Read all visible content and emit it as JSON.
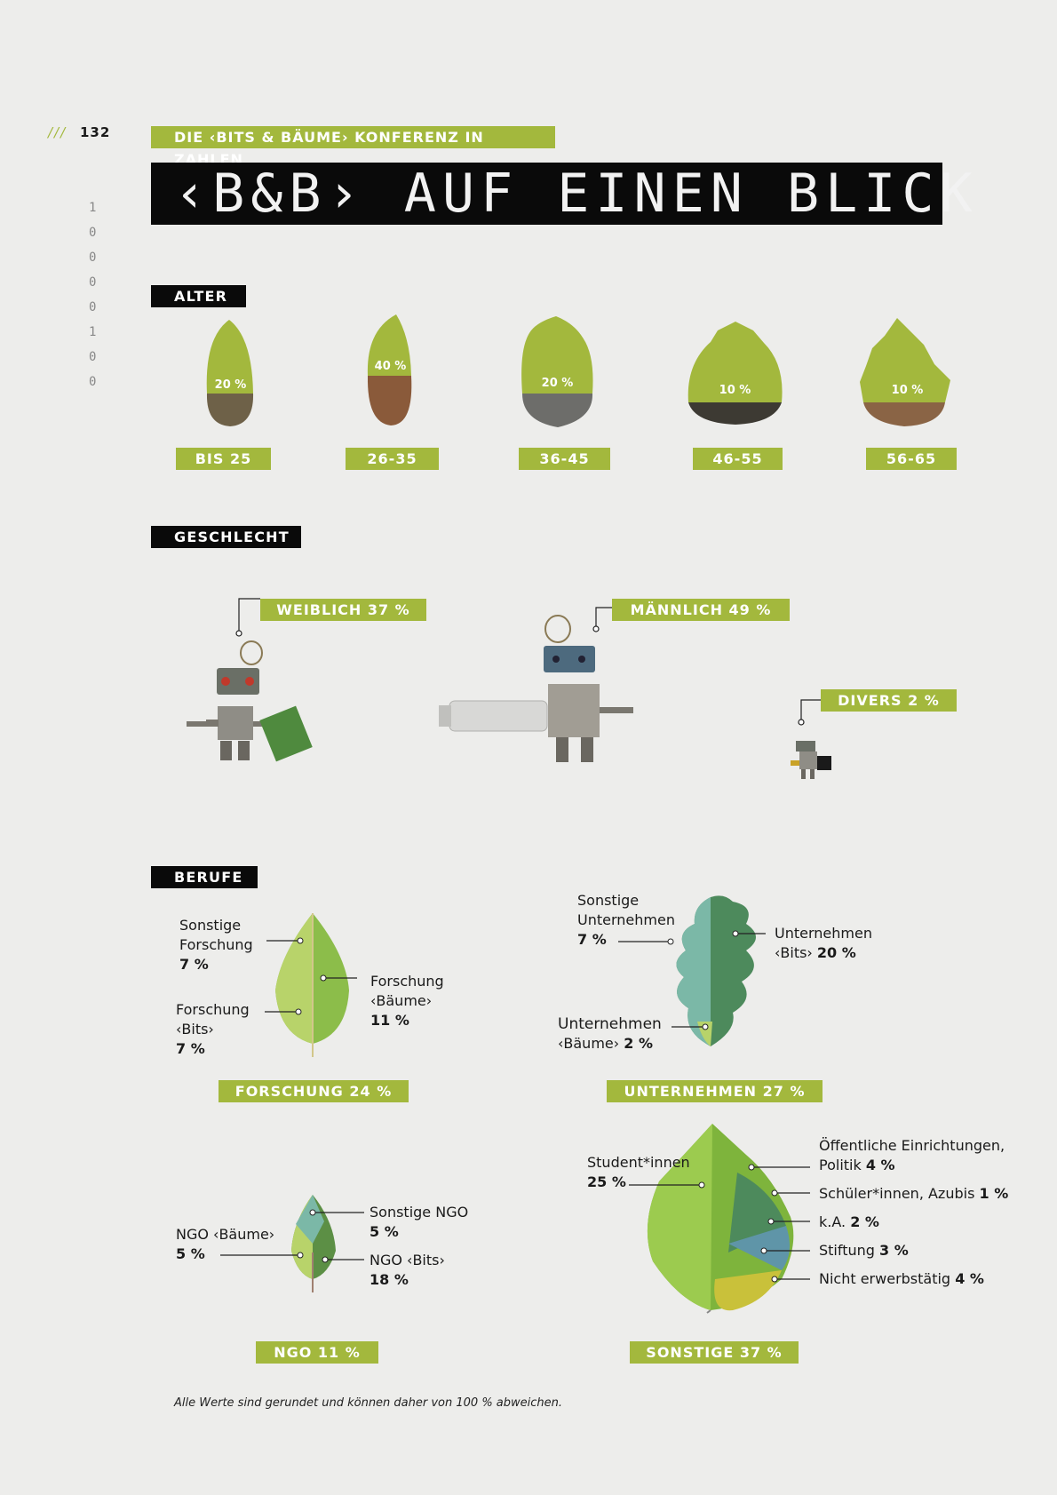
{
  "page_number": "132",
  "slashes": "///",
  "binary": [
    "1",
    "0",
    "0",
    "0",
    "0",
    "1",
    "0",
    "0"
  ],
  "kicker": "DIE ‹BITS & BÄUME› KONFERENZ IN ZAHLEN",
  "title": "‹B&B› AUF EINEN BLICK",
  "alter": {
    "heading": "ALTER",
    "groups": [
      {
        "label": "BIS 25",
        "pct": "20 %",
        "value": 20
      },
      {
        "label": "26-35",
        "pct": "40 %",
        "value": 40
      },
      {
        "label": "36-45",
        "pct": "20 %",
        "value": 20
      },
      {
        "label": "46-55",
        "pct": "10 %",
        "value": 10
      },
      {
        "label": "56-65",
        "pct": "10 %",
        "value": 10
      }
    ]
  },
  "geschlecht": {
    "heading": "GESCHLECHT",
    "weiblich": "WEIBLICH 37 %",
    "maennlich": "MÄNNLICH 49 %",
    "divers": "DIVERS 2 %"
  },
  "berufe": {
    "heading": "BERUFE",
    "forschung": {
      "tag": "FORSCHUNG 24 %",
      "sonstige_line1": "Sonstige",
      "sonstige_line2": "Forschung",
      "sonstige_pct": "7 %",
      "bits_line1": "Forschung",
      "bits_line2": "‹Bits›",
      "bits_pct": "7 %",
      "baeume_line1": "Forschung",
      "baeume_line2": "‹Bäume›",
      "baeume_pct": "11 %"
    },
    "unternehmen": {
      "tag": "UNTERNEHMEN 27 %",
      "sonstige_line1": "Sonstige",
      "sonstige_line2": "Unternehmen",
      "sonstige_pct": "7 %",
      "bits_line1": "Unternehmen",
      "bits_line2": "‹Bits›",
      "bits_pct": "20 %",
      "baeume_line1": "Unternehmen",
      "baeume_line2": "‹Bäume›",
      "baeume_pct": "2 %"
    },
    "ngo": {
      "tag": "NGO 11 %",
      "sonstige_label": "Sonstige NGO",
      "sonstige_pct": "5 %",
      "baeume_label": "NGO ‹Bäume›",
      "baeume_pct": "5 %",
      "bits_label": "NGO ‹Bits›",
      "bits_pct": "18 %"
    },
    "sonstige": {
      "tag": "SONSTIGE 37 %",
      "student_label": "Student*innen",
      "student_pct": "25 %",
      "oeffentlich_line1": "Öffentliche Einrichtungen,",
      "oeffentlich_line2": "Politik",
      "oeffentlich_pct": "4 %",
      "schueler_label": "Schüler*innen, Azubis",
      "schueler_pct": "1 %",
      "ka_label": "k.A.",
      "ka_pct": "2 %",
      "stiftung_label": "Stiftung",
      "stiftung_pct": "3 %",
      "nicht_label": "Nicht erwerbstätig",
      "nicht_pct": "4 %"
    }
  },
  "footnote": "Alle Werte sind gerundet und können daher von 100 % abweichen.",
  "colors": {
    "accent": "#a3b83d",
    "black": "#0a0a0a",
    "background": "#ededeb"
  }
}
